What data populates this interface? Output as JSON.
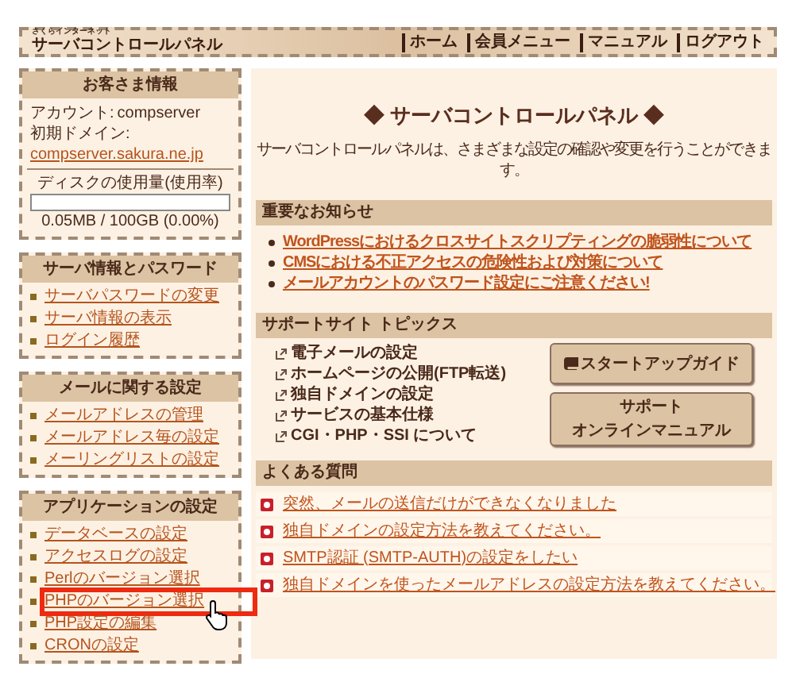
{
  "header": {
    "brand_small": "さくらインターネット",
    "brand": "サーバコントロールパネル",
    "nav": [
      "ホーム",
      "会員メニュー",
      "マニュアル",
      "ログアウト"
    ]
  },
  "customer_info": {
    "title": "お客さま情報",
    "account_label": "アカウント:",
    "account": "compserver",
    "domain_label": "初期ドメイン:",
    "domain": "compserver.sakura.ne.jp",
    "disk_title": "ディスクの使用量(使用率)",
    "level": 0,
    "disk_reading": "0.05MB / 100GB (0.00%)"
  },
  "menus": [
    {
      "title": "サーバ情報とパスワード",
      "items": [
        {
          "label": "サーバパスワードの変更",
          "highlighted": false
        },
        {
          "label": "サーバ情報の表示",
          "highlighted": false
        },
        {
          "label": "ログイン履歴",
          "highlighted": false
        }
      ]
    },
    {
      "title": "メールに関する設定",
      "items": [
        {
          "label": "メールアドレスの管理",
          "highlighted": false
        },
        {
          "label": "メールアドレス毎の設定",
          "highlighted": false
        },
        {
          "label": "メーリングリストの設定",
          "highlighted": false
        }
      ]
    },
    {
      "title": "アプリケーションの設定",
      "items": [
        {
          "label": "データベースの設定",
          "highlighted": false
        },
        {
          "label": "アクセスログの設定",
          "highlighted": false
        },
        {
          "label": "Perlのバージョン選択",
          "highlighted": false
        },
        {
          "label": "PHPのバージョン選択",
          "highlighted": true
        },
        {
          "label": "PHP設定の編集",
          "highlighted": false
        },
        {
          "label": "CRONの設定",
          "highlighted": false
        }
      ]
    }
  ],
  "main": {
    "title": "◆ サーバコントロールパネル ◆",
    "description": "サーバコントロールパネルは、さまざまな設定の確認や変更を行うことができます。",
    "notices": {
      "title": "重要なお知らせ",
      "items": [
        "WordPressにおけるクロスサイトスクリプティングの脆弱性について",
        "CMSにおける不正アクセスの危険性および対策について",
        "メールアカウントのパスワード設定にご注意ください!"
      ]
    },
    "support": {
      "title": "サポートサイト トピックス",
      "links": [
        "電子メールの設定",
        "ホームページの公開(FTP転送)",
        "独自ドメインの設定",
        "サービスの基本仕様",
        "CGI・PHP・SSI について"
      ],
      "buttons": [
        {
          "kind": "guide",
          "lines": [
            "スタートアップガイド"
          ]
        },
        {
          "kind": "plain",
          "lines": [
            "サポート",
            "オンラインマニュアル"
          ]
        }
      ]
    },
    "faq": {
      "title": "よくある質問",
      "items": [
        "突然、メールの送信だけができなくなりました",
        "独自ドメインの設定方法を教えてください。",
        "SMTP認証 (SMTP-AUTH)の設定をしたい",
        "独自ドメインを使ったメールアドレスの設定方法を教えてください。"
      ]
    }
  }
}
